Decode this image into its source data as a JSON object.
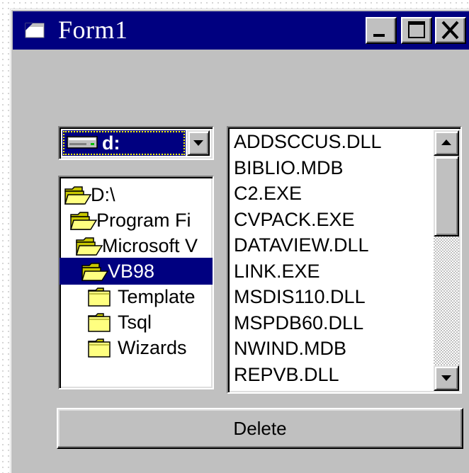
{
  "window": {
    "title": "Form1",
    "title_icon": "form-window-icon",
    "controls": {
      "minimize": "minimize-icon",
      "maximize": "maximize-icon",
      "close": "close-icon"
    },
    "colors": {
      "titlebar": "#000080",
      "face": "#c0c0c0",
      "selection": "#000080"
    }
  },
  "drive_list": {
    "selected": "d:",
    "icon": "hard-drive-icon",
    "dropdown_icon": "chevron-down-icon"
  },
  "dir_list": {
    "items": [
      {
        "label": "D:\\",
        "open": true,
        "selected": false
      },
      {
        "label": "Program Fi",
        "open": true,
        "selected": false
      },
      {
        "label": "Microsoft V",
        "open": true,
        "selected": false
      },
      {
        "label": "VB98",
        "open": true,
        "selected": true
      },
      {
        "label": "Template",
        "open": false,
        "selected": false
      },
      {
        "label": "Tsql",
        "open": false,
        "selected": false
      },
      {
        "label": "Wizards",
        "open": false,
        "selected": false
      }
    ]
  },
  "file_list": {
    "items": [
      "ADDSCCUS.DLL",
      "BIBLIO.MDB",
      "C2.EXE",
      "CVPACK.EXE",
      "DATAVIEW.DLL",
      "LINK.EXE",
      "MSDIS110.DLL",
      "MSPDB60.DLL",
      "NWIND.MDB",
      "REPVB.DLL"
    ],
    "scroll_up_icon": "scroll-up-arrow-icon",
    "scroll_down_icon": "scroll-down-arrow-icon"
  },
  "delete_button": {
    "label": "Delete"
  }
}
